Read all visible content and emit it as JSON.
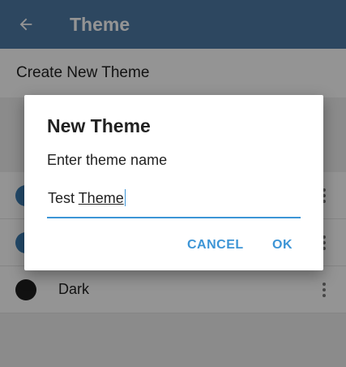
{
  "appbar": {
    "title": "Theme",
    "color": "#4f7aa6",
    "back_icon": "arrow-left-icon"
  },
  "create_theme": {
    "label": "Create New Theme"
  },
  "theme_list": [
    {
      "name": "",
      "swatch_color": "#3d7fb6"
    },
    {
      "name": "",
      "swatch_color": "#3d7fb6"
    },
    {
      "name": "Dark",
      "swatch_color": "#1e1e1e"
    }
  ],
  "dialog": {
    "title": "New Theme",
    "message": "Enter theme name",
    "input": {
      "value_prefix": "Test ",
      "value_composing": "Theme"
    },
    "cancel_label": "CANCEL",
    "ok_label": "OK",
    "accent_color": "#3d95d6"
  }
}
